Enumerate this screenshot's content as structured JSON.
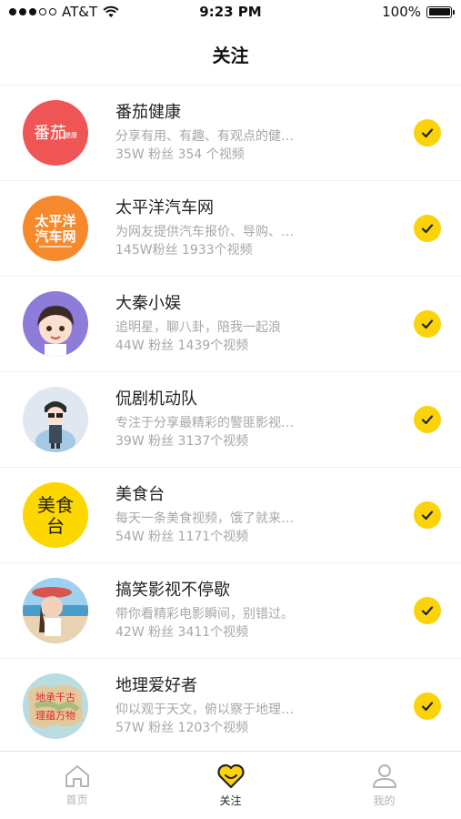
{
  "status_bar": {
    "carrier": "AT&T",
    "time": "9:23 PM",
    "battery": "100%"
  },
  "nav": {
    "title": "关注"
  },
  "accent_color": "#fbd30a",
  "following": [
    {
      "name": "番茄健康",
      "description": "分享有用、有趣、有观点的健…",
      "stats": "35W 粉丝 354 个视频",
      "avatar_text": "番茄",
      "avatar_sub": "健康",
      "avatar_bg": "#f05555",
      "avatar_fg": "#ffffff"
    },
    {
      "name": "太平洋汽车网",
      "description": "为网友提供汽车报价、导购、…",
      "stats": "145W粉丝 1933个视频",
      "avatar_text": "太平洋",
      "avatar_sub": "汽车网",
      "avatar_bg": "#f5892c",
      "avatar_fg": "#ffffff"
    },
    {
      "name": "大秦小娱",
      "description": "追明星，聊八卦，陪我一起浪",
      "stats": "44W 粉丝 1439个视频",
      "avatar_text": "",
      "avatar_sub": "",
      "avatar_bg": "#8f7bd8",
      "avatar_fg": "#ffffff"
    },
    {
      "name": "侃剧机动队",
      "description": "专注于分享最精彩的警匪影视…",
      "stats": "39W 粉丝 3137个视频",
      "avatar_text": "",
      "avatar_sub": "",
      "avatar_bg": "#dfe8f1",
      "avatar_fg": "#333333"
    },
    {
      "name": "美食台",
      "description": "每天一条美食视频，饿了就来…",
      "stats": "54W 粉丝 1171个视频",
      "avatar_text": "美食",
      "avatar_sub": "台",
      "avatar_bg": "#fcd700",
      "avatar_fg": "#222222"
    },
    {
      "name": "搞笑影视不停歇",
      "description": "带你看精彩电影瞬间，别错过。",
      "stats": "42W 粉丝 3411个视频",
      "avatar_text": "",
      "avatar_sub": "",
      "avatar_bg": "#6fb3d8",
      "avatar_fg": "#ffffff"
    },
    {
      "name": "地理爱好者",
      "description": "仰以观于天文，俯以察于地理…",
      "stats": "57W 粉丝 1203个视频",
      "avatar_text": "地承千古",
      "avatar_sub": "理蕴万物",
      "avatar_bg": "#b9dce0",
      "avatar_fg": "#d92d2d"
    }
  ],
  "tabs": [
    {
      "label": "首页",
      "icon": "home-icon",
      "active": false
    },
    {
      "label": "关注",
      "icon": "heart-icon",
      "active": true
    },
    {
      "label": "我的",
      "icon": "user-icon",
      "active": false
    }
  ]
}
